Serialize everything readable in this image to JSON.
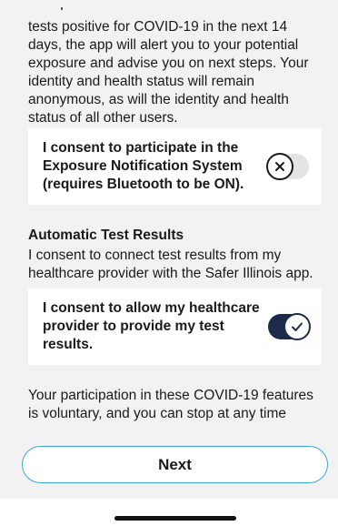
{
  "intro_text": "tests positive for COVID-19 in the next 14 days, the app will alert you to your potential exposure and advise you on next steps. Your identity and health status will remain anonymous, as will the identity and health status of all other users.",
  "exposure_consent": {
    "label": "I consent to participate in the Exposure Notification System (requires Bluetooth to be ON).",
    "enabled": false
  },
  "automatic_test_results": {
    "title": "Automatic Test Results",
    "description": "I consent to connect test results from my healthcare provider with the Safer Illinois app."
  },
  "provider_consent": {
    "label": "I consent to allow my healthcare provider to provide my test results.",
    "enabled": true
  },
  "voluntary_text": "Your participation in these COVID-19 features is voluntary, and you can stop at any time",
  "next_button_label": "Next",
  "icons": {
    "toggle_off": "x-icon",
    "toggle_on": "checkmark-icon"
  },
  "colors": {
    "toggle_on_track": "#1c2b4a",
    "toggle_off_track": "#e4e4e4",
    "next_border": "#3fa7d6",
    "background": "#f2f2f2"
  }
}
